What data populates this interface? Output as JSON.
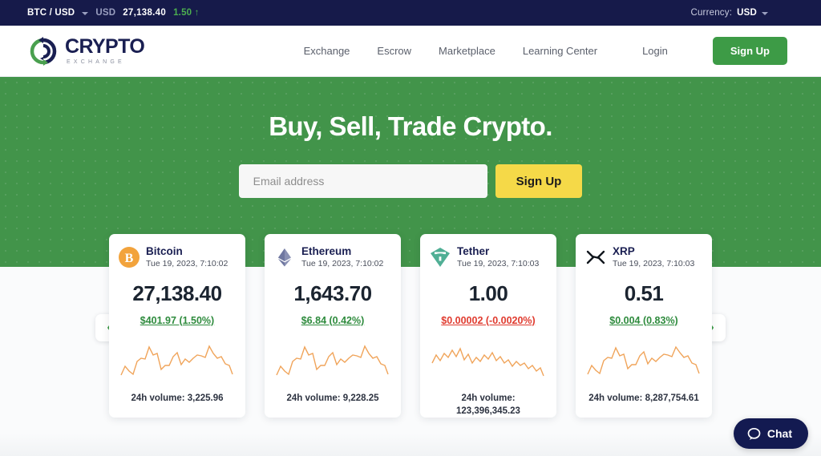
{
  "ticker": {
    "pair": "BTC / USD",
    "currency_code": "USD",
    "price": "27,138.40",
    "change": "1.50 ↑",
    "currency_label": "Currency:",
    "currency_value": "USD"
  },
  "header": {
    "logo_main": "CRYPTO",
    "logo_sub": "EXCHANGE",
    "nav": [
      {
        "label": "Exchange"
      },
      {
        "label": "Escrow"
      },
      {
        "label": "Marketplace"
      },
      {
        "label": "Learning Center"
      }
    ],
    "login_label": "Login",
    "signup_label": "Sign Up"
  },
  "hero": {
    "title": "Buy, Sell, Trade Crypto.",
    "email_placeholder": "Email address",
    "email_value": "",
    "signup_label": "Sign Up"
  },
  "carousel": {
    "prev_label": "‹",
    "next_label": "›"
  },
  "cards": [
    {
      "icon": "bitcoin-icon",
      "name": "Bitcoin",
      "time": "Tue 19, 2023, 7:10:02",
      "price": "27,138.40",
      "change": "$401.97 (1.50%)",
      "direction": "up",
      "volume": "24h volume: 3,225.96"
    },
    {
      "icon": "ethereum-icon",
      "name": "Ethereum",
      "time": "Tue 19, 2023, 7:10:02",
      "price": "1,643.70",
      "change": "$6.84 (0.42%)",
      "direction": "up",
      "volume": "24h volume: 9,228.25"
    },
    {
      "icon": "tether-icon",
      "name": "Tether",
      "time": "Tue 19, 2023, 7:10:03",
      "price": "1.00",
      "change": "$0.00002 (-0.0020%)",
      "direction": "down",
      "volume": "24h volume: 123,396,345.23"
    },
    {
      "icon": "xrp-icon",
      "name": "XRP",
      "time": "Tue 19, 2023, 7:10:03",
      "price": "0.51",
      "change": "$0.004 (0.83%)",
      "direction": "up",
      "volume": "24h volume: 8,287,754.61"
    }
  ],
  "chat": {
    "label": "Chat"
  },
  "colors": {
    "brand_green": "#42944a",
    "navy": "#161a4a",
    "accent_yellow": "#f5d948",
    "up_green": "#2e8b3d",
    "down_red": "#e03b2f",
    "spark_orange": "#f0a45a"
  }
}
